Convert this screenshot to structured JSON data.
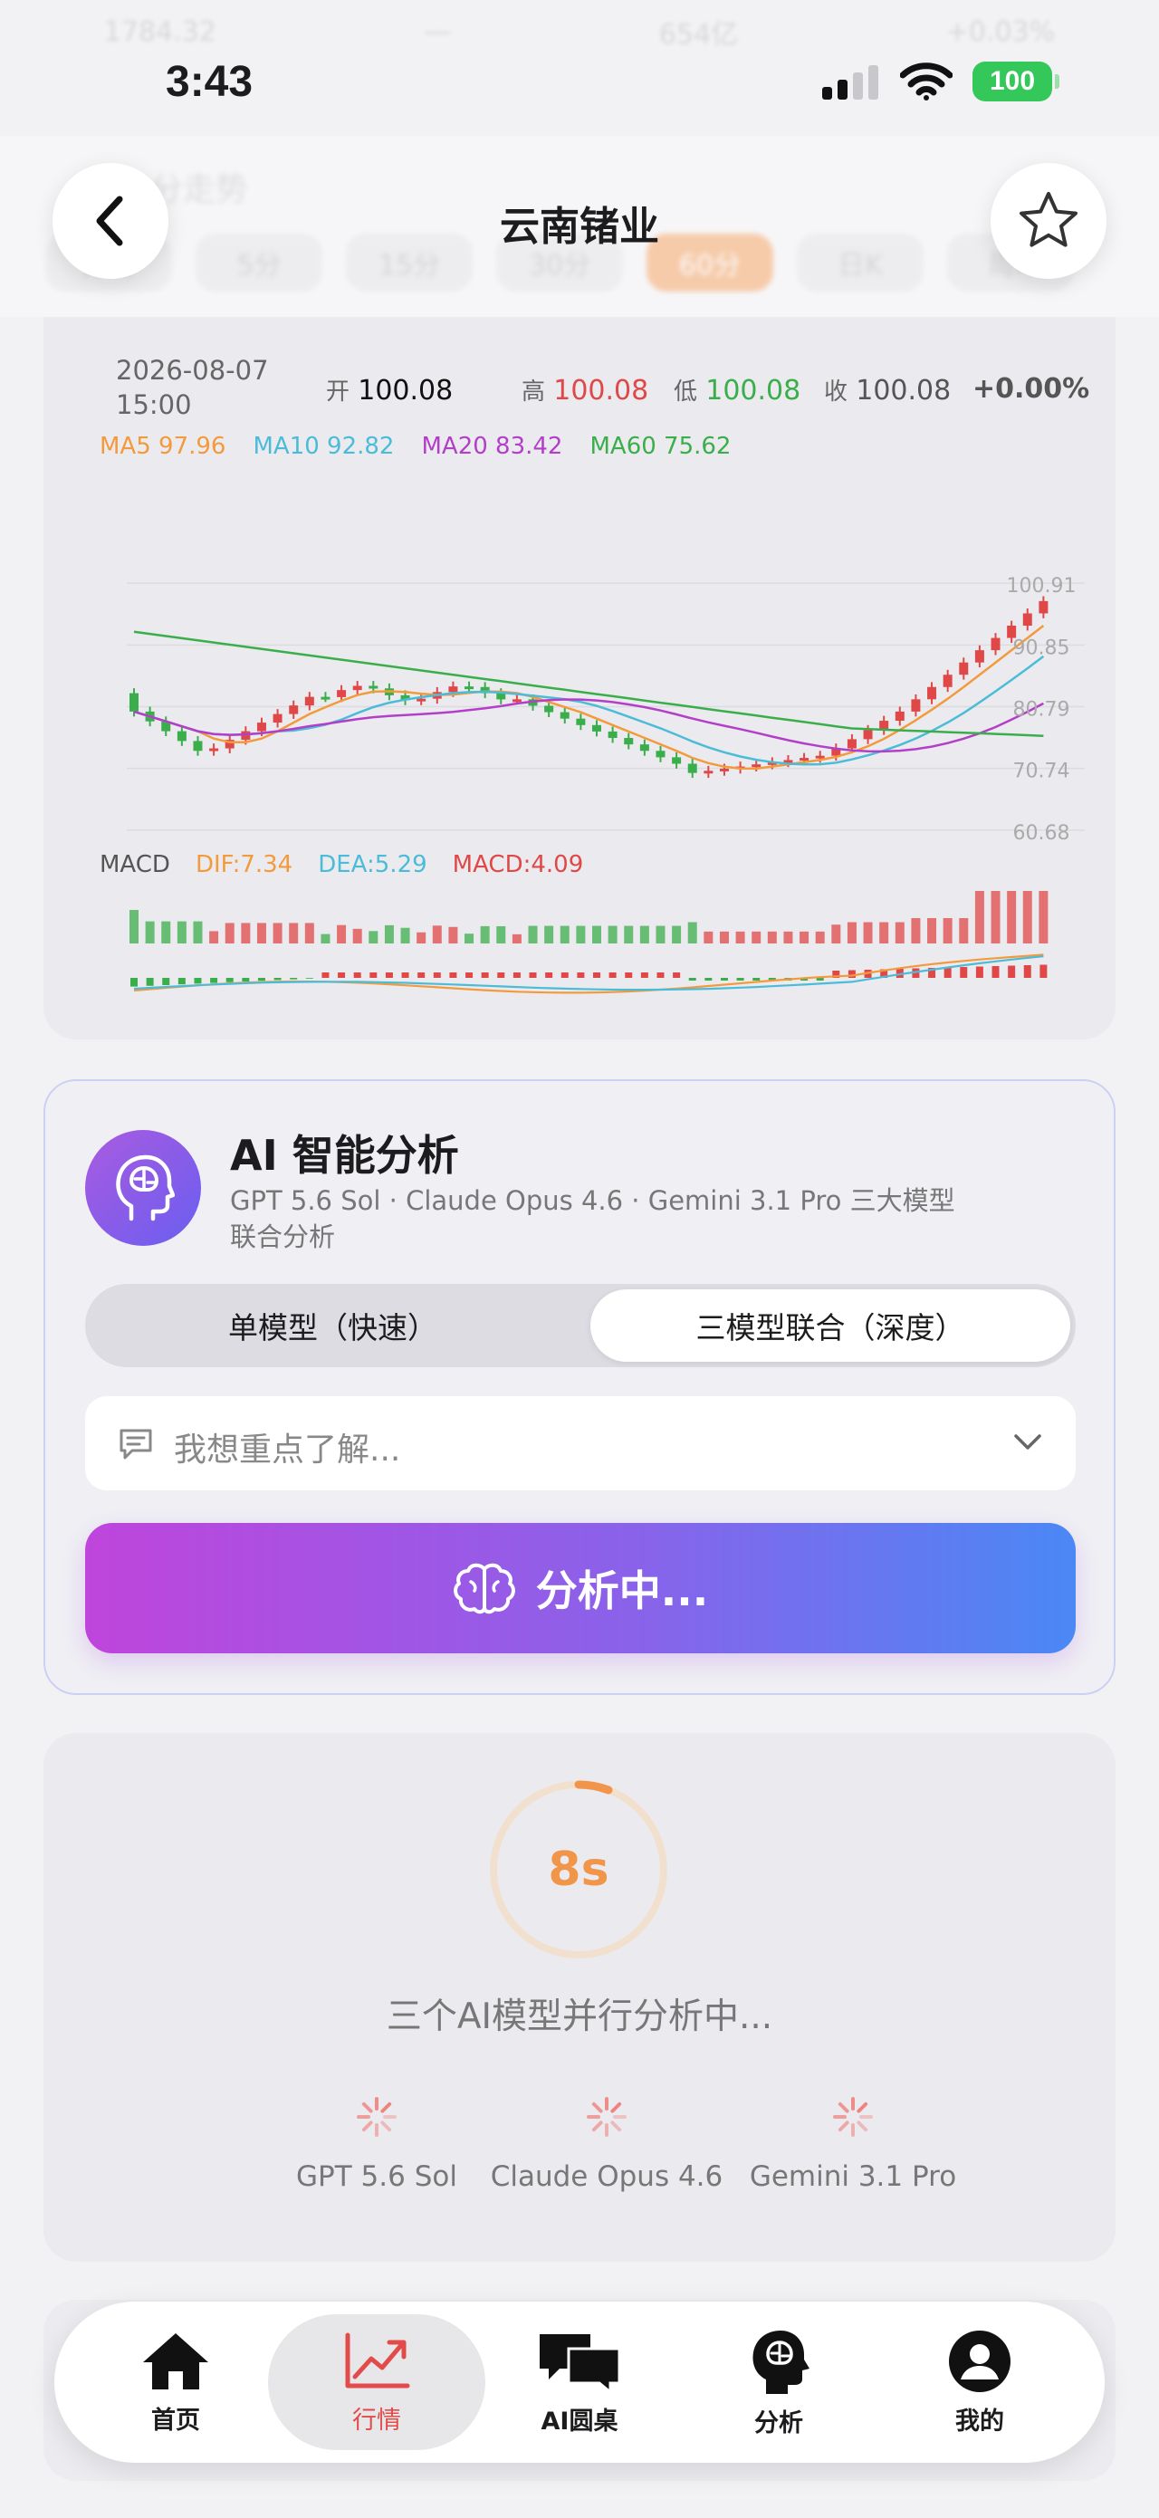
{
  "header": {
    "title": "云南锗业"
  },
  "status_bar": {
    "time": "3:43",
    "battery": "100"
  },
  "quote": {
    "date": "2026-08-07",
    "time": "15:00",
    "open_label": "开",
    "open": "100.08",
    "high_label": "高",
    "high": "100.08",
    "low_label": "低",
    "low": "100.08",
    "close_label": "收",
    "close": "100.08",
    "change": "+0.00%"
  },
  "ma": {
    "ma5": "MA5 97.96",
    "ma10": "MA10 92.82",
    "ma20": "MA20 83.42",
    "ma60": "MA60 75.62"
  },
  "price_axis": [
    "100.91",
    "90.85",
    "80.79",
    "70.74",
    "60.68"
  ],
  "macd": {
    "title": "MACD",
    "dif": "DIF:7.34",
    "dea": "DEA:5.29",
    "macd": "MACD:4.09"
  },
  "colors": {
    "up": "#e04848",
    "down": "#3aae4a",
    "ma5": "#f39a3c",
    "ma10": "#4bbcd8",
    "ma20": "#b33fc8",
    "ma60": "#3aae4a",
    "accent": "#f0954a"
  },
  "chart_data": {
    "type": "candlestick",
    "interval": "60分",
    "y_ticks": [
      100.91,
      90.85,
      80.79,
      70.74,
      60.68
    ],
    "ma_latest": {
      "MA5": 97.96,
      "MA10": 92.82,
      "MA20": 83.42,
      "MA60": 75.62
    },
    "macd_latest": {
      "DIF": 7.34,
      "DEA": 5.29,
      "MACD": 4.09
    }
  },
  "ai": {
    "title": "AI 智能分析",
    "subtitle": "GPT 5.6 Sol · Claude Opus 4.6 · Gemini 3.1 Pro 三大模型联合分析",
    "mode_single": "单模型（快速）",
    "mode_triple": "三模型联合（深度）",
    "focus_placeholder": "我想重点了解...",
    "analyze_button": "分析中..."
  },
  "progress": {
    "seconds": "8s",
    "message": "三个AI模型并行分析中...",
    "models": [
      "GPT 5.6 Sol",
      "Claude Opus 4.6",
      "Gemini 3.1 Pro"
    ]
  },
  "tabs": [
    {
      "label": "首页",
      "icon": "home-icon"
    },
    {
      "label": "行情",
      "icon": "trending-up-icon"
    },
    {
      "label": "AI圆桌",
      "icon": "chat-bubbles-icon"
    },
    {
      "label": "分析",
      "icon": "brain-head-icon"
    },
    {
      "label": "我的",
      "icon": "user-circle-icon"
    }
  ]
}
